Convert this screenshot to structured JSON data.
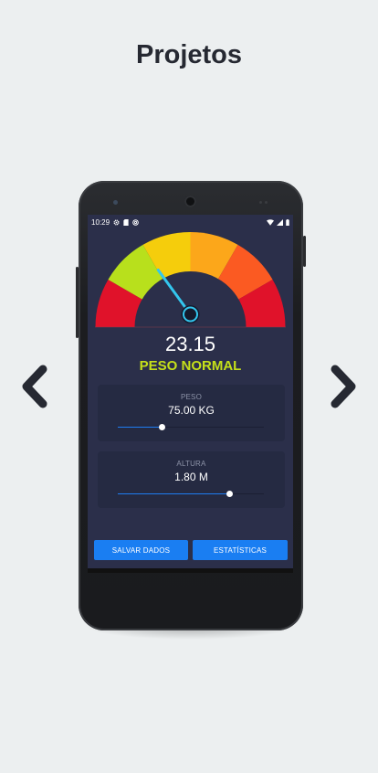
{
  "page": {
    "title": "Projetos"
  },
  "navigation": {
    "prev_icon": "chevron-left-icon",
    "next_icon": "chevron-right-icon"
  },
  "status_bar": {
    "time": "10:29",
    "icons": [
      "gear-icon",
      "sd-card-icon",
      "at-sign-icon",
      "wifi-icon",
      "signal-icon",
      "battery-icon"
    ]
  },
  "gauge": {
    "segments": [
      "#e0122a",
      "#b8e01c",
      "#f5cd0c",
      "#fca71a",
      "#fb5a22",
      "#e0122a"
    ],
    "needle_color": "#33c6ee",
    "needle_fraction": 0.3
  },
  "result": {
    "bmi": "23.15",
    "status": "PESO NORMAL",
    "status_color": "#c5e01a"
  },
  "weight": {
    "label": "PESO",
    "value": "75.00 KG",
    "slider_fraction": 0.3
  },
  "height": {
    "label": "ALTURA",
    "value": "1.80 M",
    "slider_fraction": 0.76
  },
  "actions": {
    "save_label": "SALVAR DADOS",
    "stats_label": "ESTATÍSTICAS",
    "button_color": "#1a7ef2"
  }
}
